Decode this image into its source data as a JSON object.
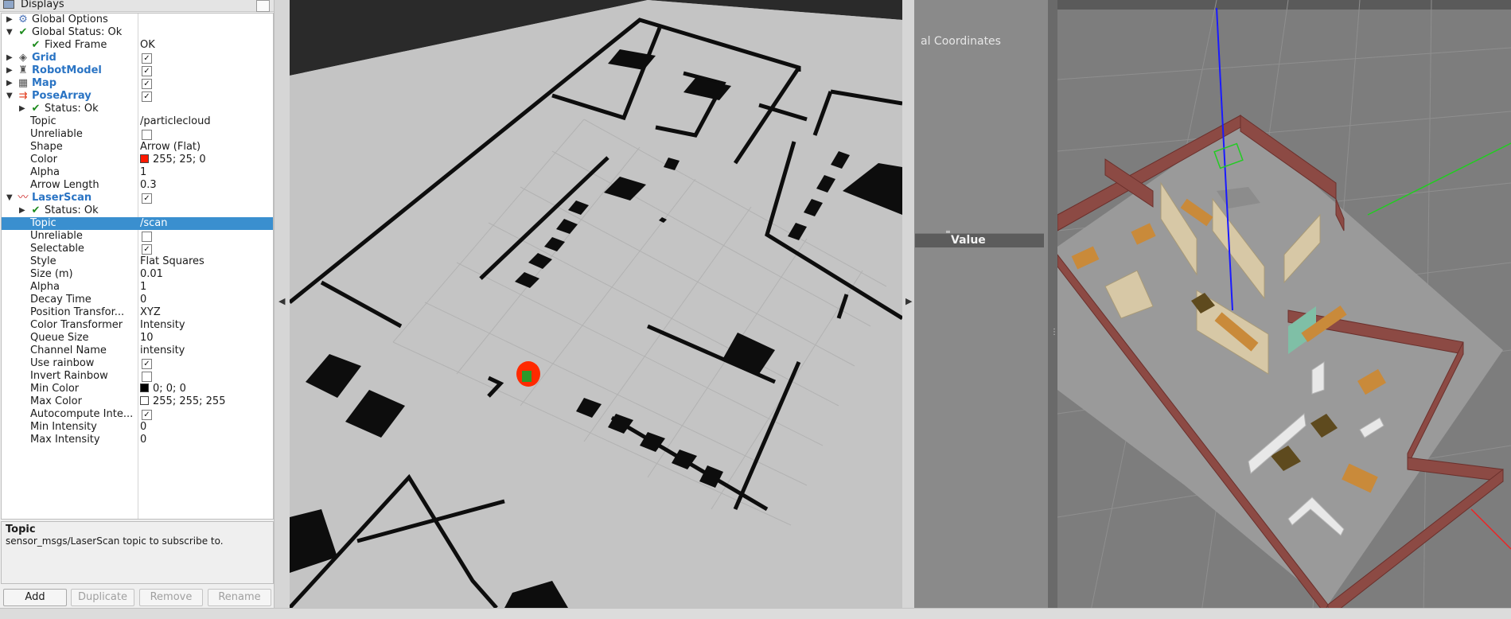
{
  "displays_panel": {
    "title": "Displays",
    "tree": [
      {
        "label": "Global Options",
        "value": "",
        "icon": "gear-icon",
        "expander": "collapsed",
        "style": "normal",
        "level": 0
      },
      {
        "label": "Global Status: Ok",
        "value": "",
        "icon": "check-icon",
        "expander": "expanded",
        "style": "normal",
        "level": 0
      },
      {
        "label": "Fixed Frame",
        "value": "OK",
        "icon": "check-icon",
        "expander": "none",
        "style": "normal",
        "level": 1
      },
      {
        "label": "Grid",
        "value": "",
        "checkbox": true,
        "icon": "grid-icon",
        "expander": "collapsed",
        "style": "blue",
        "level": 0
      },
      {
        "label": "RobotModel",
        "value": "",
        "checkbox": true,
        "icon": "robot-icon",
        "expander": "collapsed",
        "style": "blue",
        "level": 0
      },
      {
        "label": "Map",
        "value": "",
        "checkbox": true,
        "icon": "map-icon",
        "expander": "collapsed",
        "style": "blue",
        "level": 0
      },
      {
        "label": "PoseArray",
        "value": "",
        "checkbox": true,
        "icon": "posearray-icon",
        "expander": "expanded",
        "style": "blue",
        "level": 0
      },
      {
        "label": "Status: Ok",
        "value": "",
        "icon": "check-icon",
        "expander": "collapsed",
        "style": "normal",
        "level": 1
      },
      {
        "label": "Topic",
        "value": "/particlecloud",
        "expander": "none",
        "style": "normal",
        "level": 1
      },
      {
        "label": "Unreliable",
        "value": "",
        "checkbox": false,
        "expander": "none",
        "style": "normal",
        "level": 1
      },
      {
        "label": "Shape",
        "value": "Arrow (Flat)",
        "expander": "none",
        "style": "normal",
        "level": 1
      },
      {
        "label": "Color",
        "value": "255; 25; 0",
        "swatch": "#ff1900",
        "expander": "none",
        "style": "normal",
        "level": 1
      },
      {
        "label": "Alpha",
        "value": "1",
        "expander": "none",
        "style": "normal",
        "level": 1
      },
      {
        "label": "Arrow Length",
        "value": "0.3",
        "expander": "none",
        "style": "normal",
        "level": 1
      },
      {
        "label": "LaserScan",
        "value": "",
        "checkbox": true,
        "icon": "laserscan-icon",
        "expander": "expanded",
        "style": "blue",
        "level": 0
      },
      {
        "label": "Status: Ok",
        "value": "",
        "icon": "check-icon",
        "expander": "collapsed",
        "style": "normal",
        "level": 1
      },
      {
        "label": "Topic",
        "value": "/scan",
        "expander": "none",
        "style": "normal",
        "level": 1,
        "selected": true
      },
      {
        "label": "Unreliable",
        "value": "",
        "checkbox": false,
        "expander": "none",
        "style": "normal",
        "level": 1
      },
      {
        "label": "Selectable",
        "value": "",
        "checkbox": true,
        "expander": "none",
        "style": "normal",
        "level": 1
      },
      {
        "label": "Style",
        "value": "Flat Squares",
        "expander": "none",
        "style": "normal",
        "level": 1
      },
      {
        "label": "Size (m)",
        "value": "0.01",
        "expander": "none",
        "style": "normal",
        "level": 1
      },
      {
        "label": "Alpha",
        "value": "1",
        "expander": "none",
        "style": "normal",
        "level": 1
      },
      {
        "label": "Decay Time",
        "value": "0",
        "expander": "none",
        "style": "normal",
        "level": 1
      },
      {
        "label": "Position Transfor...",
        "value": "XYZ",
        "expander": "none",
        "style": "normal",
        "level": 1
      },
      {
        "label": "Color Transformer",
        "value": "Intensity",
        "expander": "none",
        "style": "normal",
        "level": 1
      },
      {
        "label": "Queue Size",
        "value": "10",
        "expander": "none",
        "style": "normal",
        "level": 1
      },
      {
        "label": "Channel Name",
        "value": "intensity",
        "expander": "none",
        "style": "normal",
        "level": 1
      },
      {
        "label": "Use rainbow",
        "value": "",
        "checkbox": true,
        "expander": "none",
        "style": "normal",
        "level": 1
      },
      {
        "label": "Invert Rainbow",
        "value": "",
        "checkbox": false,
        "expander": "none",
        "style": "normal",
        "level": 1
      },
      {
        "label": "Min Color",
        "value": "0; 0; 0",
        "swatch": "#000000",
        "expander": "none",
        "style": "normal",
        "level": 1
      },
      {
        "label": "Max Color",
        "value": "255; 255; 255",
        "swatch": "#ffffff",
        "expander": "none",
        "style": "normal",
        "level": 1
      },
      {
        "label": "Autocompute Inte...",
        "value": "",
        "checkbox": true,
        "expander": "none",
        "style": "normal",
        "level": 1
      },
      {
        "label": "Min Intensity",
        "value": "0",
        "expander": "none",
        "style": "normal",
        "level": 1
      },
      {
        "label": "Max Intensity",
        "value": "0",
        "expander": "none",
        "style": "normal",
        "level": 1
      }
    ],
    "help": {
      "title": "Topic",
      "description": "sensor_msgs/LaserScan topic to subscribe to."
    },
    "buttons": {
      "add": "Add",
      "duplicate": "Duplicate",
      "remove": "Remove",
      "rename": "Rename"
    }
  },
  "tool_panel": {
    "partial_text": "al Coordinates",
    "value_header": "Value"
  },
  "colors": {
    "selection": "#3a8fcf",
    "display_name_blue": "#2a74c4",
    "map_free_space": "#c4c4c4",
    "map_obstacle": "#0d0d0d",
    "robot_red": "#ff2a00",
    "grid_axis_blue": "#1a1aff",
    "grid_axis_green": "#22cc22",
    "brick_wall": "#8c4a44"
  }
}
